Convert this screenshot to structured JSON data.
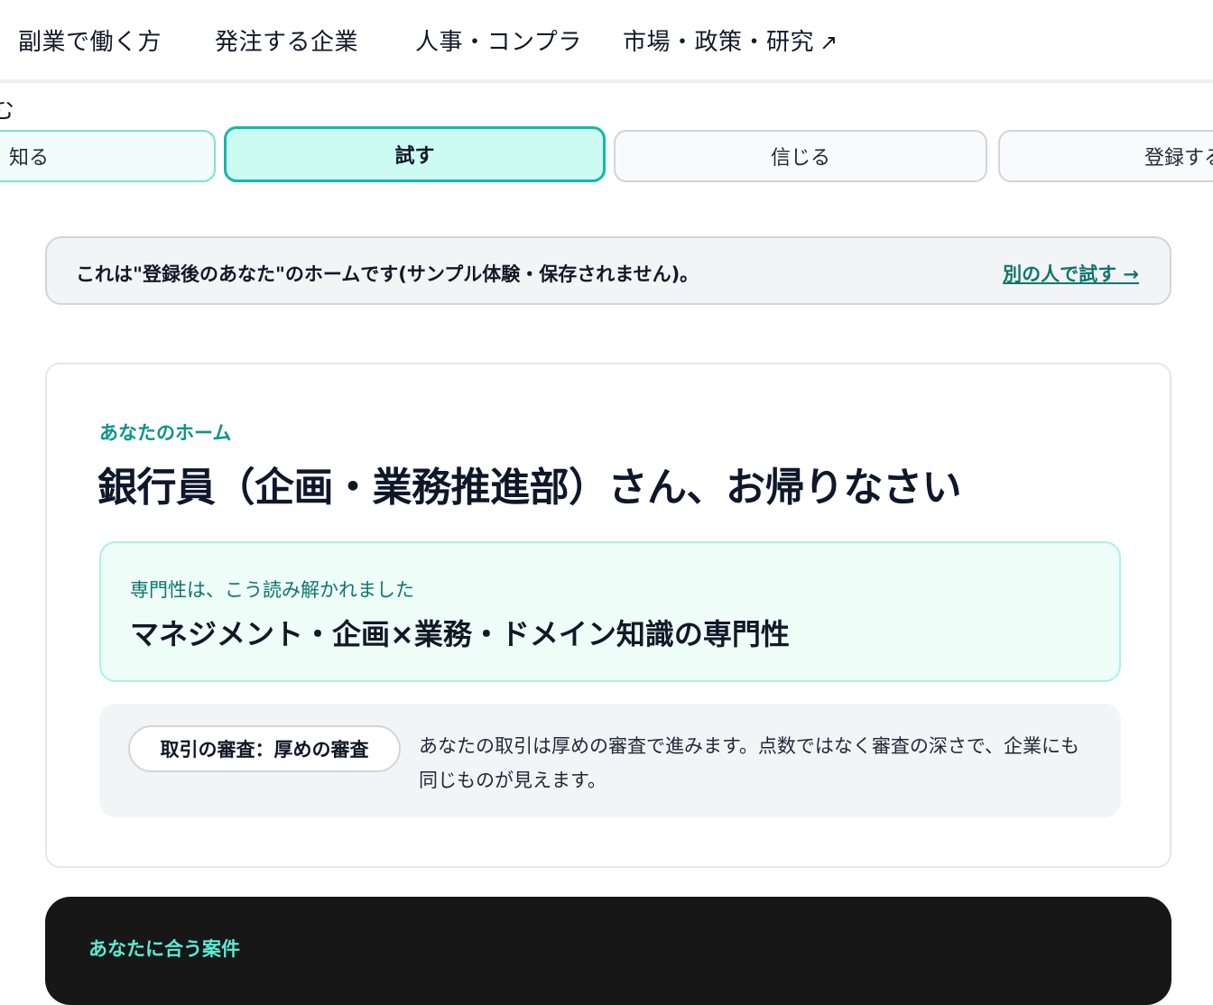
{
  "top_nav": {
    "items": [
      {
        "label": "副業で働く方"
      },
      {
        "label": "発注する企業"
      },
      {
        "label": "人事・コンプラ"
      },
      {
        "label": "市場・政策・研究",
        "icon": "external-link-icon",
        "icon_glyph": "↗"
      }
    ]
  },
  "page_heading_cut": "む",
  "steps": [
    {
      "label": "知る",
      "state": "past"
    },
    {
      "label": "試す",
      "state": "active"
    },
    {
      "label": "信じる",
      "state": "upcoming"
    },
    {
      "label": "登録する",
      "state": "upcoming"
    }
  ],
  "sample_banner": {
    "text": "これは\"登録後のあなた\"のホームです(サンプル体験・保存されません)。",
    "link": "別の人で試す →"
  },
  "home": {
    "eyebrow": "あなたのホーム",
    "greeting": "銀行員（企画・業務推進部）さん、お帰りなさい",
    "expertise": {
      "label": "専門性は、こう読み解かれました",
      "value": "マネジメント・企画×業務・ドメイン知識の専門性"
    },
    "review": {
      "pill": "取引の審査：厚めの審査",
      "description": "あなたの取引は厚めの審査で進みます。点数ではなく審査の深さで、企業にも同じものが見えます。"
    }
  },
  "matches": {
    "title": "あなたに合う案件"
  },
  "colors": {
    "accent": "#14b8a6",
    "accent_text": "#0d9488",
    "link": "#0f766e",
    "dark_bg": "#171717"
  }
}
